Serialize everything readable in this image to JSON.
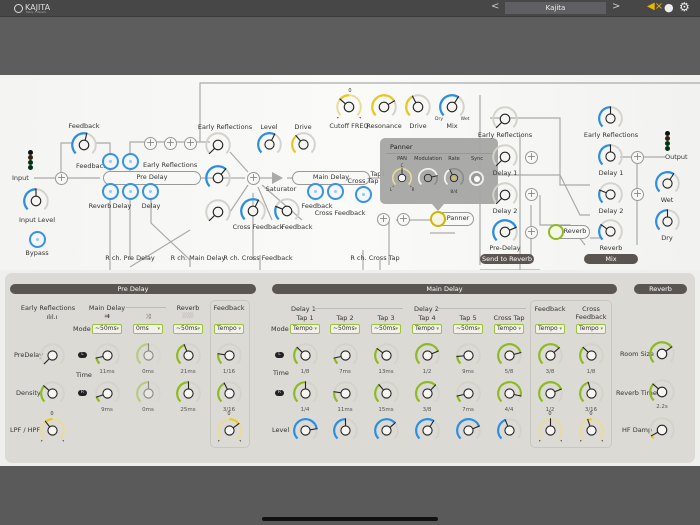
{
  "colors": {
    "green": "#8dbb1f",
    "blue": "#2a8fe3",
    "yellow": "#e8c820",
    "track": "#d4d2ca",
    "bar": "#5a5550"
  },
  "topbar": {
    "logo": "KAJITA",
    "logo_sub": "Delay — Reverb",
    "prev": "<",
    "next": ">",
    "preset": "Kajita",
    "icons": [
      "mute-speaker-icon",
      "palette-icon",
      "gear-icon"
    ]
  },
  "diagram": {
    "labels": {
      "input": "Input",
      "input_level": "Input Level",
      "bypass": "Bypass",
      "feedback_top": "Feedback",
      "feedback_btn": "Feedback",
      "pre_delay": "Pre Delay",
      "early_reflections_btn": "Early Reflections",
      "reverb_btn": "Reverb",
      "delay_btn1": "Delay",
      "delay_btn2": "Delay",
      "early_reflections": "Early Reflections",
      "level": "Level",
      "drive": "Drive",
      "saturator": "Saturator",
      "main_delay": "Main Delay",
      "feedback_btn2": "Feedback",
      "cross_feedback_btn": "Cross Feedback",
      "cross_feedback": "Cross Feedback",
      "feedback": "Feedback",
      "cutoff": "Cutoff FREQ",
      "resonance": "Resonance",
      "filter_drive": "Drive",
      "mix": "Mix",
      "dry": "Dry",
      "wet": "Wet",
      "cross_tap": "Cross Tap",
      "tap": "Tap1",
      "panner": "Panner",
      "r_pre_delay": "R ch. Pre Delay",
      "r_main_delay": "R ch. Main Delay",
      "r_cross_feedback": "R ch. Cross Feedback",
      "r_cross_tap": "R ch. Cross Tap",
      "send_er": "Early Reflections",
      "send_d1": "Delay 1",
      "send_d2": "Delay 2",
      "send_pre": "Pre-Delay",
      "reverb": "Reverb",
      "mix_er": "Early Reflections",
      "mix_d1": "Delay 1",
      "mix_d2": "Delay 2",
      "mix_reverb": "Reverb",
      "output": "Output",
      "out_wet": "Wet",
      "out_dry": "Dry",
      "send_to_reverb": "Send to Reverb",
      "mix_bar": "Mix",
      "cutoff_zero": "0"
    },
    "knobs": {
      "feedback": {
        "v": 0.55,
        "c": "blue"
      },
      "input_level": {
        "v": 0.5,
        "c": "blue"
      },
      "er_top": {
        "v": 0,
        "c": "blue"
      },
      "er_mid": {
        "v": 0.65,
        "c": "blue"
      },
      "er_bot": {
        "v": 0,
        "c": "blue"
      },
      "level": {
        "v": 0.6,
        "c": "blue"
      },
      "drive": {
        "v": 0.35,
        "c": "yellow"
      },
      "cross_feedback": {
        "v": 0.6,
        "c": "blue"
      },
      "feedback_r": {
        "v": 0.25,
        "c": "blue"
      },
      "cutoff": {
        "v": 0.32,
        "c": "yellow",
        "bi": true
      },
      "resonance": {
        "v": 0.72,
        "c": "yellow"
      },
      "filter_drive": {
        "v": 0.4,
        "c": "yellow"
      },
      "mix": {
        "v": 0.62,
        "c": "blue"
      },
      "send_er": {
        "v": 0,
        "c": "blue"
      },
      "send_d1": {
        "v": 0,
        "c": "blue"
      },
      "send_d2": {
        "v": 0,
        "c": "blue"
      },
      "send_pre": {
        "v": 0.75,
        "c": "blue"
      },
      "mix_er": {
        "v": 0.5,
        "c": "blue"
      },
      "mix_d1": {
        "v": 0.5,
        "c": "blue"
      },
      "mix_d2": {
        "v": 0.25,
        "c": "blue"
      },
      "mix_reverb": {
        "v": 0.3,
        "c": "blue"
      },
      "wet": {
        "v": 0.62,
        "c": "blue"
      },
      "dry": {
        "v": 0.5,
        "c": "blue"
      }
    }
  },
  "panner": {
    "title": "Panner",
    "pan": "PAN",
    "modulation": "Modulation",
    "rate": "Rate",
    "sync": "Sync",
    "c": "C",
    "l": "L",
    "r": "R",
    "rate_value": "8/4",
    "knobs": {
      "pan": {
        "v": 0.5,
        "c": "yellow",
        "bi": true
      },
      "modulation": {
        "v": 0.78,
        "c": "white"
      },
      "rate": {
        "v": 0.4,
        "c": "white"
      }
    }
  },
  "pre_delay": {
    "title": "Pre Delay",
    "early_reflections": "Early Reflections",
    "main_delay": "Main Delay",
    "reverb": "Reverb",
    "feedback": "Feedback",
    "mode": "Mode",
    "time": "Time",
    "l": "L",
    "r": "R",
    "rows": [
      "PreDelay",
      "Density",
      "LPF / HPF"
    ],
    "zero": "0",
    "er_knobs": [
      {
        "v": 0,
        "c": "green"
      },
      {
        "v": 0.32,
        "c": "green"
      },
      {
        "v": 0.36,
        "c": "yellow",
        "bi": true
      }
    ],
    "columns": [
      {
        "mode": "~50ms",
        "L": {
          "v": 0.12,
          "c": "green"
        },
        "Lval": "11ms",
        "R": {
          "v": 0.1,
          "c": "green"
        },
        "Rval": "9ms"
      },
      {
        "mode": "0ms",
        "L": {
          "v": 0.5,
          "c": "green",
          "faded": true
        },
        "Lval": "0ms",
        "R": {
          "v": 0.5,
          "c": "green",
          "faded": true
        },
        "Rval": "0ms"
      },
      {
        "mode": "~50ms",
        "L": {
          "v": 0.42,
          "c": "green"
        },
        "Lval": "21ms",
        "R": {
          "v": 0.5,
          "c": "green"
        },
        "Rval": "25ms"
      },
      {
        "mode": "Tempo",
        "L": {
          "v": 0.2,
          "c": "green"
        },
        "Lval": "1/16",
        "R": {
          "v": 0.4,
          "c": "green"
        },
        "Rval": "3/16",
        "X": {
          "v": 0.7,
          "c": "yellow",
          "bi": true
        }
      }
    ]
  },
  "main_delay": {
    "title": "Main Delay",
    "delay1": "Delay 1",
    "delay2": "Delay 2",
    "mode": "Mode",
    "time": "Time",
    "level": "Level",
    "l": "L",
    "r": "R",
    "zero": "0",
    "columns": [
      {
        "name": "Tap 1",
        "mode": "Tempo",
        "L": {
          "v": 0.33,
          "c": "green"
        },
        "Lval": "1/8",
        "R": {
          "v": 0.5,
          "c": "green"
        },
        "Rval": "1/4",
        "X": {
          "v": 0.8,
          "c": "blue"
        }
      },
      {
        "name": "Tap 2",
        "mode": "~50ms",
        "L": {
          "v": 0.12,
          "c": "green"
        },
        "Lval": "7ms",
        "R": {
          "v": 0.2,
          "c": "green"
        },
        "Rval": "11ms",
        "X": {
          "v": 0.5,
          "c": "blue"
        }
      },
      {
        "name": "Tap 3",
        "mode": "~50ms",
        "L": {
          "v": 0.3,
          "c": "green"
        },
        "Lval": "13ms",
        "R": {
          "v": 0.35,
          "c": "green"
        },
        "Rval": "15ms",
        "X": {
          "v": 0.68,
          "c": "blue"
        }
      },
      {
        "name": "Tap 4",
        "mode": "Tempo",
        "L": {
          "v": 0.75,
          "c": "green"
        },
        "Lval": "1/2",
        "R": {
          "v": 0.66,
          "c": "green"
        },
        "Rval": "3/8",
        "X": {
          "v": 0.62,
          "c": "blue"
        }
      },
      {
        "name": "Tap 5",
        "mode": "~50ms",
        "L": {
          "v": 0.15,
          "c": "green"
        },
        "Lval": "9ms",
        "R": {
          "v": 0.12,
          "c": "green"
        },
        "Rval": "7ms",
        "X": {
          "v": 0.75,
          "c": "blue"
        }
      },
      {
        "name": "Cross Tap",
        "mode": "Tempo",
        "L": {
          "v": 0.78,
          "c": "green"
        },
        "Lval": "5/8",
        "R": {
          "v": 0.88,
          "c": "green"
        },
        "Rval": "4/4",
        "X": {
          "v": 0.42,
          "c": "blue"
        }
      },
      {
        "name": "Feedback",
        "mode": "Tempo",
        "L": {
          "v": 0.68,
          "c": "green"
        },
        "Lval": "3/8",
        "R": {
          "v": 0.75,
          "c": "green"
        },
        "Rval": "1/2",
        "X": {
          "v": 0.5,
          "c": "yellow",
          "bi": true
        }
      },
      {
        "name": "Cross Feedback",
        "mode": "Tempo",
        "L": {
          "v": 0.33,
          "c": "green"
        },
        "Lval": "1/8",
        "R": {
          "v": 0.44,
          "c": "green"
        },
        "Rval": "3/16",
        "X": {
          "v": 0.43,
          "c": "yellow",
          "bi": true
        }
      }
    ]
  },
  "reverb": {
    "title": "Reverb",
    "room_size": "Room Size",
    "reverb_time": "Reverb Time",
    "reverb_time_val": "2.2s",
    "hf_damp": "HF Damp",
    "knobs": {
      "room_size": {
        "v": 0.7,
        "c": "green"
      },
      "reverb_time": {
        "v": 0.32,
        "c": "green"
      },
      "hf_damp": {
        "v": 0.06,
        "c": "yellow"
      }
    }
  }
}
